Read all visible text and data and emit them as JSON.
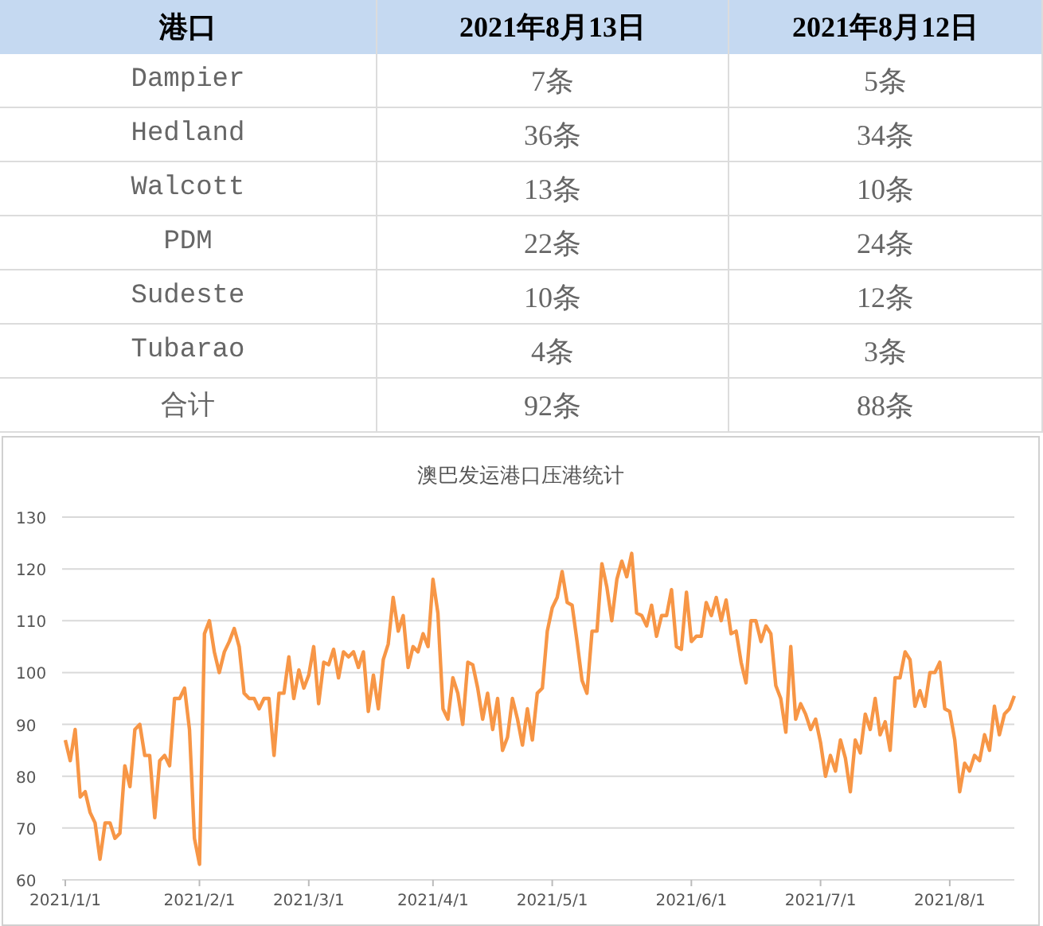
{
  "table": {
    "columns": [
      "港口",
      "2021年8月13日",
      "2021年8月12日"
    ],
    "rows": [
      [
        "Dampier",
        "7条",
        "5条"
      ],
      [
        "Hedland",
        "36条",
        "34条"
      ],
      [
        "Walcott",
        "13条",
        "10条"
      ],
      [
        "PDM",
        "22条",
        "24条"
      ],
      [
        "Sudeste",
        "10条",
        "12条"
      ],
      [
        "Tubarao",
        "4条",
        "3条"
      ],
      [
        "合计",
        "92条",
        "88条"
      ]
    ]
  },
  "chart": {
    "chart_data": {
      "type": "line",
      "title": "澳巴发运港口压港统计",
      "series": [
        {
          "color": "#f79646",
          "values": [
            87,
            83,
            89,
            76,
            77,
            73,
            71,
            64,
            71,
            71,
            68,
            69,
            82,
            78,
            89,
            90,
            84,
            84,
            72,
            83,
            84,
            82,
            95,
            95,
            97,
            89,
            68,
            63,
            107.5,
            110,
            104,
            100,
            104,
            106,
            108.5,
            105,
            96,
            95,
            95,
            93,
            95,
            95,
            84,
            96,
            96,
            103,
            95,
            100.5,
            97,
            99.5,
            105,
            94,
            102,
            101.5,
            104.5,
            99,
            104,
            103,
            104,
            101,
            104,
            92.5,
            99.5,
            93,
            102.5,
            105.5,
            114.5,
            108,
            111,
            101,
            105,
            104,
            107.5,
            105,
            118,
            111.5,
            93,
            91,
            99,
            96,
            90,
            102,
            101.5,
            97,
            91,
            96,
            89,
            95,
            85,
            87.5,
            95,
            91,
            86,
            93,
            87,
            96,
            97,
            108,
            112.5,
            114.5,
            119.5,
            113.5,
            113,
            106,
            98.5,
            96,
            108,
            108,
            121,
            116.5,
            110,
            118,
            121.5,
            118.5,
            123,
            111.5,
            111,
            109,
            113,
            107,
            111,
            111,
            116,
            105,
            104.5,
            115.5,
            106,
            107,
            107,
            113.5,
            111,
            114.5,
            110,
            114,
            107.5,
            108,
            102,
            98,
            110,
            110,
            106,
            109,
            107.5,
            97.5,
            95,
            88.5,
            105,
            91,
            94,
            92,
            89,
            91,
            86.5,
            80,
            84,
            81,
            87,
            83.5,
            77,
            87,
            84.5,
            92,
            89,
            95,
            88,
            90.5,
            85,
            99,
            99,
            104,
            102.5,
            93.5,
            96.5,
            93.5,
            100,
            100,
            102,
            93,
            92.5,
            87,
            77,
            82.5,
            81,
            84,
            83,
            88,
            85,
            93.5,
            88,
            92,
            93,
            95.5
          ]
        }
      ],
      "ylim": [
        60,
        130
      ],
      "grid": true,
      "categories": [
        "2021/1/1",
        null,
        null,
        null,
        null,
        null,
        null,
        null,
        null,
        null,
        null,
        null,
        null,
        null,
        null,
        null,
        null,
        null,
        null,
        null,
        null,
        null,
        null,
        null,
        null,
        null,
        null,
        "2021/2/1",
        null,
        null,
        null,
        null,
        null,
        null,
        null,
        null,
        null,
        null,
        null,
        null,
        null,
        null,
        null,
        null,
        null,
        null,
        null,
        null,
        null,
        "2021/3/1",
        null,
        null,
        null,
        null,
        null,
        null,
        null,
        null,
        null,
        null,
        null,
        null,
        null,
        null,
        null,
        null,
        null,
        null,
        null,
        null,
        null,
        null,
        null,
        null,
        "2021/4/1",
        null,
        null,
        null,
        null,
        null,
        null,
        null,
        null,
        null,
        null,
        null,
        null,
        null,
        null,
        null,
        null,
        null,
        null,
        null,
        null,
        null,
        null,
        null,
        "2021/5/1",
        null,
        null,
        null,
        null,
        null,
        null,
        null,
        null,
        null,
        null,
        null,
        null,
        null,
        null,
        null,
        null,
        null,
        null,
        null,
        null,
        null,
        null,
        null,
        null,
        null,
        null,
        null,
        "2021/6/1",
        null,
        null,
        null,
        null,
        null,
        null,
        null,
        null,
        null,
        null,
        null,
        null,
        null,
        null,
        null,
        null,
        null,
        null,
        null,
        null,
        null,
        null,
        null,
        null,
        null,
        "2021/7/1",
        null,
        null,
        null,
        null,
        null,
        null,
        null,
        null,
        null,
        null,
        null,
        null,
        null,
        null,
        null,
        null,
        null,
        null,
        null,
        null,
        null,
        null,
        null,
        null,
        null,
        "2021/8/1",
        null,
        null,
        null,
        null,
        null,
        null,
        null,
        null,
        null,
        null,
        null,
        null,
        null
      ],
      "yticks": [
        60,
        70,
        80,
        90,
        100,
        110,
        120,
        130
      ]
    }
  }
}
